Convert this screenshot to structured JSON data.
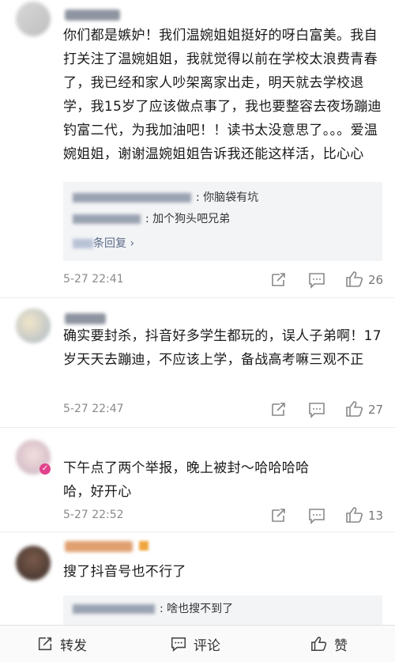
{
  "comments": [
    {
      "text": "你们都是嫉妒！我们温婉姐姐挺好的呀白富美。我自打关注了温婉姐姐，我就觉得以前在学校太浪费青春了，我已经和家人吵架离家出走，明天就去学校退学，我15岁了应该做点事了，我也要整容去夜场蹦迪钓富二代，为我加油吧！！读书太没意思了。。。爱温婉姐姐，谢谢温婉姐姐告诉我还能这样活，比心心",
      "replies": [
        "你脑袋有坑",
        "加个狗头吧兄弟"
      ],
      "more_replies": "条回复 ›",
      "time": "5-27 22:41",
      "likes": "26"
    },
    {
      "text": "确实要封杀，抖音好多学生都玩的，误人子弟啊！17岁天天去蹦迪，不应该上学，备战高考嘛三观不正",
      "time": "5-27 22:47",
      "likes": "27"
    },
    {
      "text": "下午点了两个举报，晚上被封～哈哈哈哈哈，好开心",
      "time": "5-27 22:52",
      "likes": "13"
    },
    {
      "text": "搜了抖音号也不行了",
      "replies": [
        "啥也搜不到了"
      ]
    }
  ],
  "bottom_bar": {
    "repost": "转发",
    "comment": "评论",
    "like": "赞"
  }
}
